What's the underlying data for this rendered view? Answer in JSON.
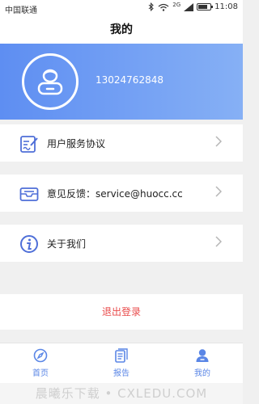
{
  "status_bar": {
    "carrier": "中国联通",
    "network": "2G",
    "time": "11:08",
    "battery_level": 0.75
  },
  "header": {
    "title": "我的"
  },
  "profile": {
    "phone": "13024762848"
  },
  "menu": {
    "items": [
      {
        "label": "用户服务协议",
        "icon": "document-edit-icon"
      },
      {
        "label": "意见反馈：service@huocc.cc",
        "icon": "mail-tray-icon"
      },
      {
        "label": "关于我们",
        "icon": "info-icon"
      }
    ]
  },
  "logout_label": "退出登录",
  "tabs": [
    {
      "label": "首页",
      "icon": "compass-icon"
    },
    {
      "label": "报告",
      "icon": "report-icon"
    },
    {
      "label": "我的",
      "icon": "user-icon",
      "active": true
    }
  ],
  "watermark": "晨曦乐下载 • CXLEDU.COM",
  "colors": {
    "accent": "#5a86e6",
    "header_gradient_start": "#5e8ef2",
    "header_gradient_end": "#86b0f5",
    "logout": "#e94b4b"
  }
}
